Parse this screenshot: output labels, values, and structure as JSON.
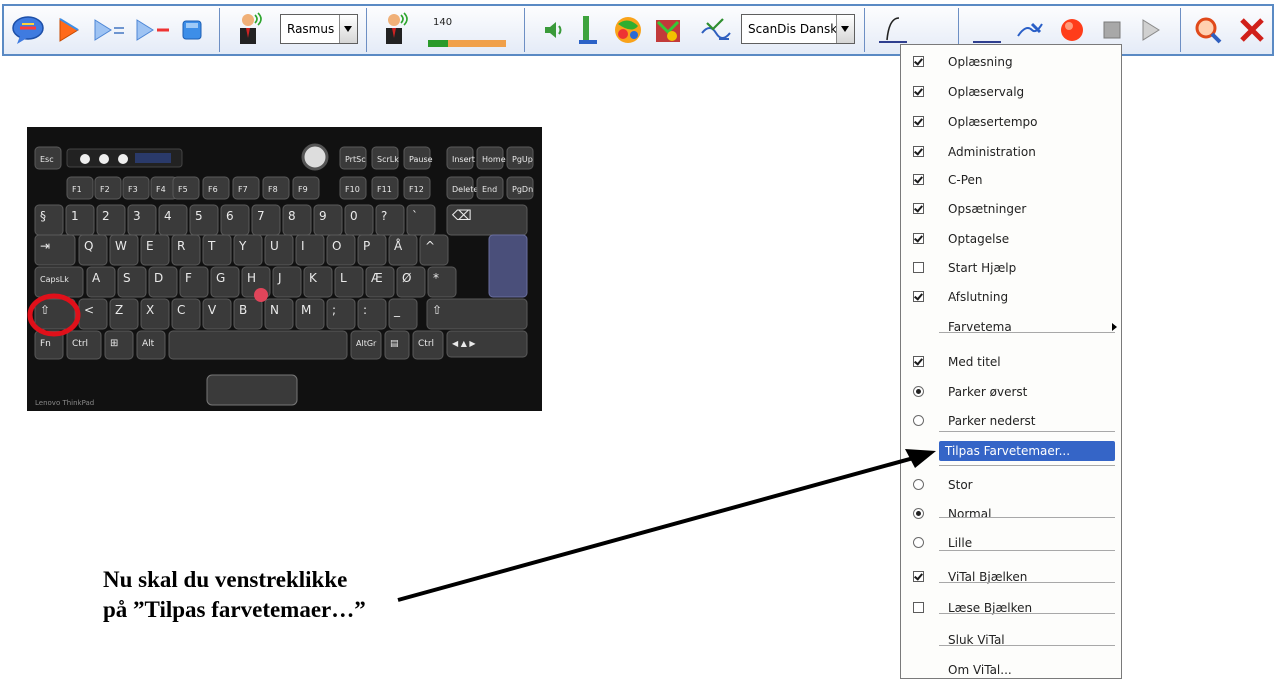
{
  "toolbar": {
    "voice_combo": {
      "value": "Rasmus"
    },
    "speed": {
      "value": "140",
      "level_fraction": 0.25
    },
    "dictionary_combo": {
      "value": "ScanDis Dansk"
    },
    "icons": [
      "speech-bubble-icon",
      "play-icon",
      "play-sentence-icon",
      "play-word-icon",
      "stop-icon",
      "voice-person-icon",
      "speed-person-icon",
      "volume-icon",
      "cpen-icon",
      "color-theme-icon",
      "tools-icon",
      "spelling-icon",
      "ruler-icon",
      "line-icon",
      "pen-icon",
      "record-icon",
      "stop-record-icon",
      "playback-icon",
      "search-icon",
      "close-icon"
    ]
  },
  "menu": {
    "items": [
      {
        "label": "Oplæsning",
        "type": "check",
        "checked": true
      },
      {
        "label": "Oplæservalg",
        "type": "check",
        "checked": true
      },
      {
        "label": "Oplæsertempo",
        "type": "check",
        "checked": true
      },
      {
        "label": "Administration",
        "type": "check",
        "checked": true
      },
      {
        "label": "C-Pen",
        "type": "check",
        "checked": true
      },
      {
        "label": "Opsætninger",
        "type": "check",
        "checked": true
      },
      {
        "label": "Optagelse",
        "type": "check",
        "checked": true
      },
      {
        "label": "Start Hjælp",
        "type": "check",
        "checked": false
      },
      {
        "label": "Afslutning",
        "type": "check",
        "checked": true
      },
      {
        "label": "Farvetema",
        "type": "submenu"
      },
      {
        "label": "Med titel",
        "type": "check",
        "checked": true
      },
      {
        "label": "Parker øverst",
        "type": "radio",
        "checked": true
      },
      {
        "label": "Parker nederst",
        "type": "radio",
        "checked": false
      },
      {
        "label": "Tilpas Farvetemaer...",
        "type": "highlighted"
      },
      {
        "label": "Stor",
        "type": "radio",
        "checked": false
      },
      {
        "label": "Normal",
        "type": "radio",
        "checked": true
      },
      {
        "label": "Lille",
        "type": "radio",
        "checked": false
      },
      {
        "label": "ViTal Bjælken",
        "type": "check",
        "checked": true
      },
      {
        "label": "Læse Bjælken",
        "type": "check",
        "checked": false
      },
      {
        "label": "Sluk ViTal",
        "type": "plain"
      },
      {
        "label": "Om ViTal...",
        "type": "plain"
      }
    ]
  },
  "instruction": {
    "line1": "Nu skal du venstreklikke",
    "line2": "på ”Tilpas farvetemaer…”"
  },
  "keyboard": {
    "top_keys": [
      "Esc",
      "F1",
      "F2",
      "F3",
      "F4",
      "F5",
      "F6",
      "F7",
      "F8",
      "F9",
      "F10",
      "F11",
      "F12",
      "PrtSc",
      "ScrLk",
      "Pause",
      "Insert",
      "Home",
      "PgUp",
      "Delete",
      "End",
      "PgDn"
    ],
    "row1": [
      "§",
      "1",
      "2",
      "3",
      "4",
      "5",
      "6",
      "7",
      "8",
      "9",
      "0",
      "?",
      "`"
    ],
    "row2": [
      "Q",
      "W",
      "E",
      "R",
      "T",
      "Y",
      "U",
      "I",
      "O",
      "P",
      "Å",
      "^"
    ],
    "row3": [
      "CapsLk",
      "A",
      "S",
      "D",
      "F",
      "G",
      "H",
      "J",
      "K",
      "L",
      "Æ",
      "Ø",
      "*"
    ],
    "row4": [
      "<",
      "Z",
      "X",
      "C",
      "V",
      "B",
      "N",
      "M",
      ";",
      ":",
      "_"
    ],
    "row5": [
      "Fn",
      "Ctrl",
      "Alt",
      "AltGr",
      "Ctrl"
    ],
    "brand": "Lenovo ThinkPad"
  },
  "colors": {
    "accent": "#3565c7",
    "toolbar_border": "#5a8ac4",
    "highlight_circle": "#e0101a",
    "trackpoint": "#e0455a"
  }
}
